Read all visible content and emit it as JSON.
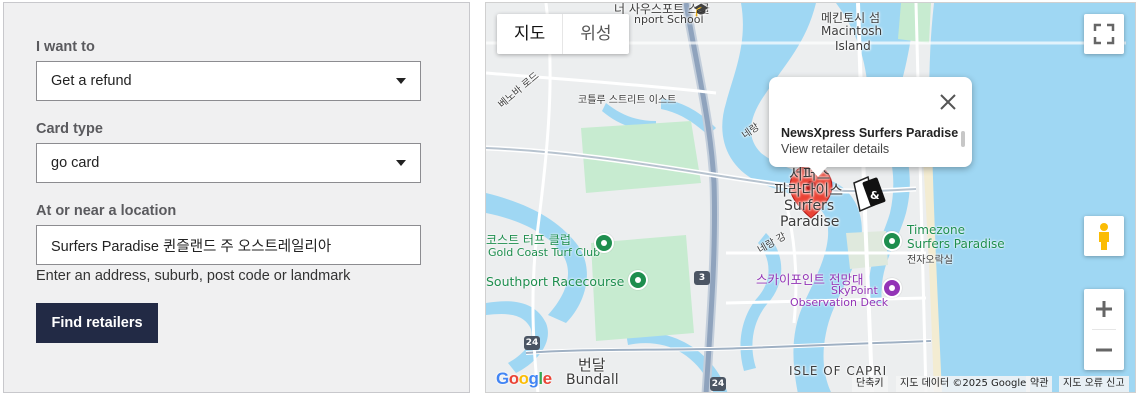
{
  "form": {
    "want_label": "I want to",
    "want_value": "Get a refund",
    "card_label": "Card type",
    "card_value": "go card",
    "location_label": "At or near a location",
    "location_value": "Surfers Paradise 퀸즐랜드 주 오스트레일리아",
    "location_hint": "Enter an address, suburb, post code or landmark",
    "find_button": "Find retailers"
  },
  "map": {
    "map_type": {
      "map": "지도",
      "satellite": "위성"
    },
    "popup": {
      "title": "NewsXpress Surfers Paradise",
      "link": "View retailer details"
    },
    "labels": {
      "school": "너 사우스포트 스쿨",
      "school2": "nport School",
      "macintosh_ko": "메킨토시 섬",
      "macintosh_en1": "Macintosh",
      "macintosh_en2": "Island",
      "bellbowrie": "베노바 로드",
      "coastal": "코틀루 스트리트 이스트",
      "surfers_ko1": "서퍼스",
      "surfers_ko2": "파라다이스",
      "surfers_en1": "Surfers",
      "surfers_en2": "Paradise",
      "turf_ko": "코스트 터프 클럽",
      "turf_en": "Gold Coast Turf Club",
      "timezone1": "Timezone",
      "timezone2": "Surfers Paradise",
      "timezone_ko": "전자오락실",
      "nerang": "네랑 강",
      "nerang2": "네랑",
      "racecourse": "Southport Racecourse",
      "skypoint_ko": "스카이포인트 전망대",
      "skypoint_en1": "SkyPoint",
      "skypoint_en2": "Observation Deck",
      "bundall_ko": "번달",
      "bundall_en": "Bundall",
      "isle": "ISLE OF CAPRI",
      "shield_3": "3",
      "shield_24a": "24",
      "shield_24b": "24"
    },
    "google_logo": "Google",
    "attribution": {
      "shortcuts": "단축키",
      "data": "지도 데이터 ©2025 Google",
      "terms": "약관",
      "report": "지도 오류 신고"
    }
  },
  "colors": {
    "button_bg": "#222a45",
    "water": "#9fd7f3",
    "park": "#c7ebd0",
    "marker": "#ea4335"
  }
}
